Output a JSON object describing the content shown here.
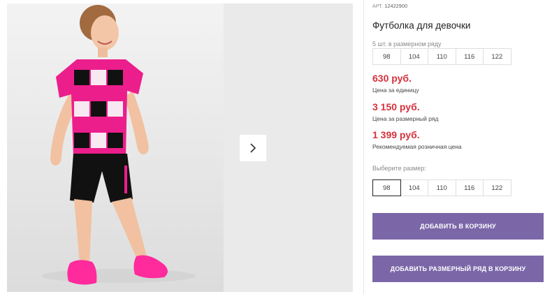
{
  "product": {
    "article_label": "АРТ.",
    "article_number": "12422900",
    "title": "Футболка для девочки"
  },
  "size_run": {
    "label": "5 шт. в размерном ряду",
    "sizes": [
      "98",
      "104",
      "110",
      "116",
      "122"
    ]
  },
  "prices": [
    {
      "amount": "630 руб.",
      "note": "Цена за единицу"
    },
    {
      "amount": "3 150 руб.",
      "note": "Цена за размерный ряд"
    },
    {
      "amount": "1 399 руб.",
      "note": "Рекомендуемая розничная цена"
    }
  ],
  "size_picker": {
    "label": "Выберите размер:",
    "sizes": [
      "98",
      "104",
      "110",
      "116",
      "122"
    ],
    "selected": "98"
  },
  "buttons": {
    "add_to_cart": "ДОБАВИТЬ В КОРЗИНУ",
    "add_size_run": "ДОБАВИТЬ РАЗМЕРНЫЙ РЯД В КОРЗИНУ"
  },
  "gallery": {
    "next_icon": "chevron-right-icon"
  },
  "colors": {
    "price": "#d6323c",
    "button": "#7b67a8",
    "shirt_pink": "#ec1e8c",
    "shoe_pink": "#ff2a9c"
  }
}
